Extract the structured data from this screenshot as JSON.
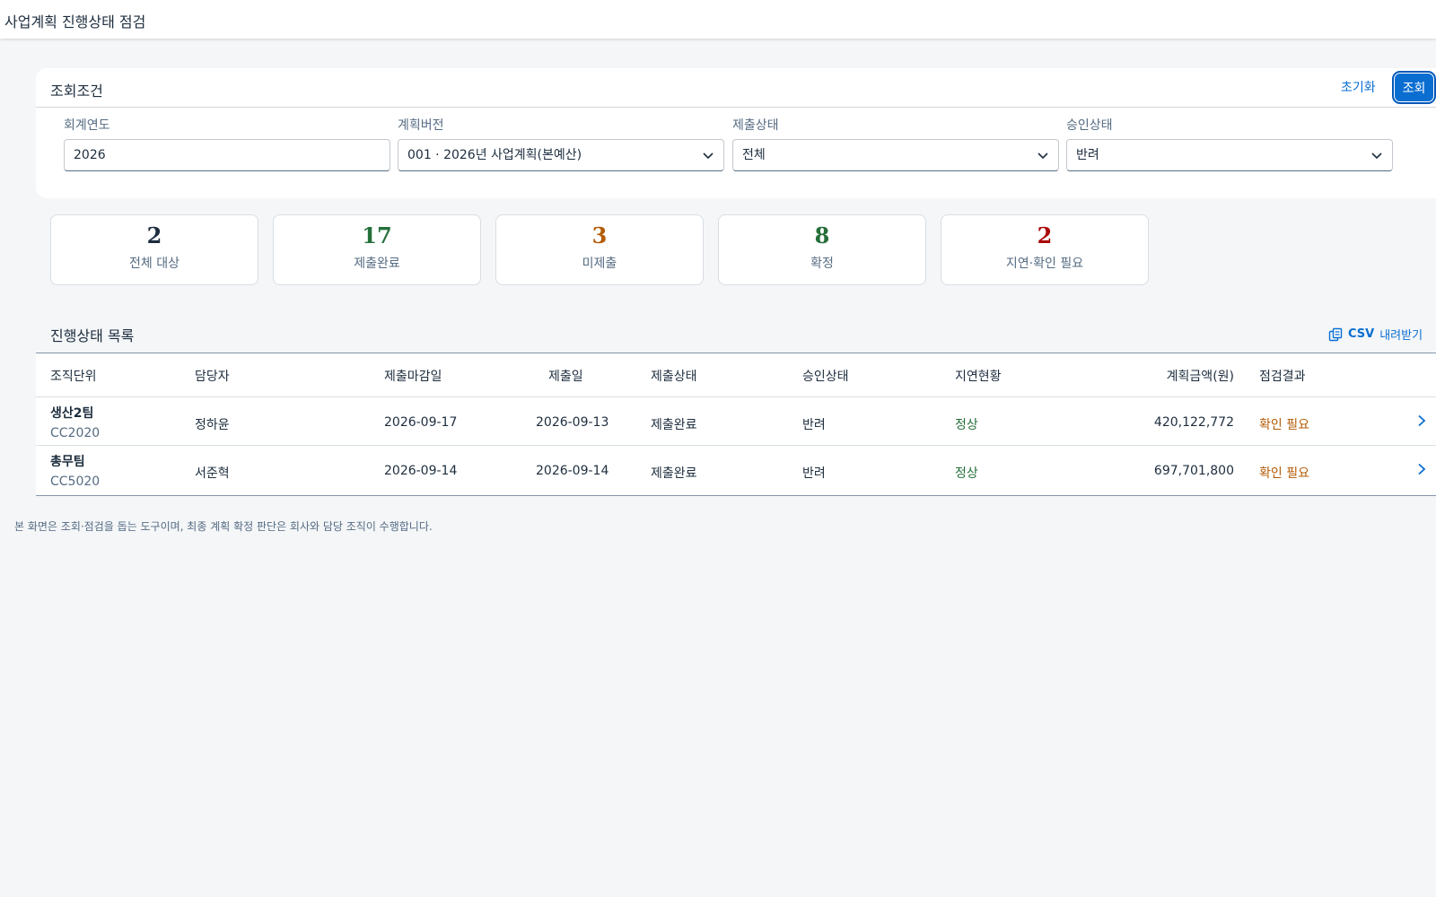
{
  "app": {
    "title": "사업계획 진행상태 점검"
  },
  "filter": {
    "title": "조회조건",
    "reset_label": "초기화",
    "search_label": "조회",
    "fields": [
      {
        "label": "회계연도",
        "value": "2026"
      },
      {
        "label": "계획버전",
        "value": "001 · 2026년 사업계획(본예산)"
      },
      {
        "label": "제출상태",
        "value": "전체"
      },
      {
        "label": "승인상태",
        "value": "반려"
      }
    ]
  },
  "kpis": [
    {
      "value": "2",
      "label": "전체 대상",
      "color": "#1d2d3e"
    },
    {
      "value": "17",
      "label": "제출완료",
      "color": "#256f3a"
    },
    {
      "value": "3",
      "label": "미제출",
      "color": "#b45b05"
    },
    {
      "value": "8",
      "label": "확정",
      "color": "#256f3a"
    },
    {
      "value": "2",
      "label": "지연·확인 필요",
      "color": "#aa0808"
    }
  ],
  "list": {
    "title": "진행상태 목록",
    "csv_label": "CSV",
    "csv_suffix": "내려받기",
    "columns": [
      "조직단위",
      "담당자",
      "제출마감일",
      "제출일",
      "제출상태",
      "승인상태",
      "지연현황",
      "계획금액(원)",
      "점검결과"
    ],
    "rows": [
      {
        "org_name": "생산2팀",
        "org_code": "CC2020",
        "owner": "정하윤",
        "deadline": "2026-09-17",
        "submitted": "2026-09-13",
        "submit_status": "제출완료",
        "approval": "반려",
        "delay": "정상",
        "amount": "420,122,772",
        "result": "확인 필요"
      },
      {
        "org_name": "총무팀",
        "org_code": "CC5020",
        "owner": "서준혁",
        "deadline": "2026-09-14",
        "submitted": "2026-09-14",
        "submit_status": "제출완료",
        "approval": "반려",
        "delay": "정상",
        "amount": "697,701,800",
        "result": "확인 필요"
      }
    ]
  },
  "footnote": "본 화면은 조회·점검을 돕는 도구이며, 최종 계획 확정 판단은 회사와 담당 조직이 수행합니다.",
  "colors": {
    "accent": "#0a6ed1",
    "positive": "#256f3a",
    "warning": "#b45b05",
    "negative": "#aa0808"
  }
}
